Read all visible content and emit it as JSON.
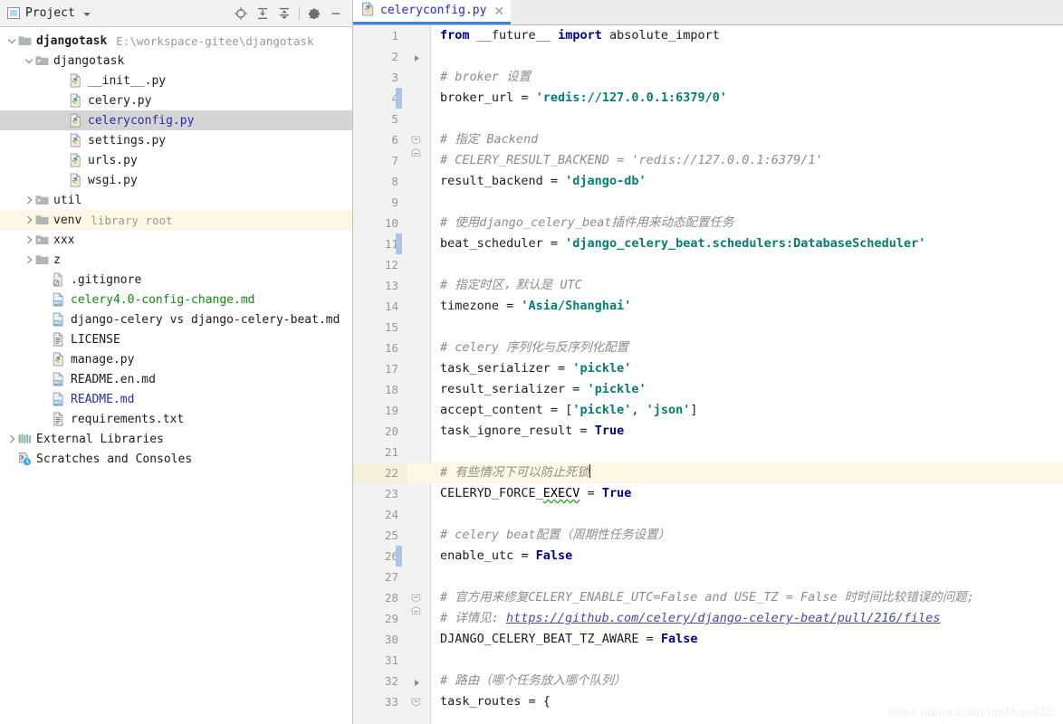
{
  "toolwindow": {
    "title": "Project",
    "icon": "project-panel-icon",
    "dropdown_icon": "chevron-down-icon",
    "buttons": [
      {
        "name": "locate-icon",
        "tooltip": "Select Opened File"
      },
      {
        "name": "expand-all-icon",
        "tooltip": "Expand All"
      },
      {
        "name": "collapse-all-icon",
        "tooltip": "Collapse All"
      },
      {
        "name": "settings-gear-icon",
        "tooltip": "Settings"
      },
      {
        "name": "hide-icon",
        "tooltip": "Hide"
      }
    ]
  },
  "tree": [
    {
      "label": "djangotask",
      "sub": "E:\\workspace-gitee\\djangotask",
      "indent": 0,
      "state": "expanded",
      "icon": "folder-icon",
      "color": "dark",
      "bold": true,
      "row": "project-root"
    },
    {
      "label": "djangotask",
      "sub": "",
      "indent": 1,
      "state": "expanded",
      "icon": "folder-source-icon",
      "color": "dark",
      "bold": false,
      "row": "package-djangotask"
    },
    {
      "label": "__init__.py",
      "sub": "",
      "indent": 3,
      "state": "leaf",
      "icon": "python-file-icon",
      "color": "dark",
      "bold": false,
      "row": "file-init"
    },
    {
      "label": "celery.py",
      "sub": "",
      "indent": 3,
      "state": "leaf",
      "icon": "python-file-icon",
      "color": "dark",
      "bold": false,
      "row": "file-celery"
    },
    {
      "label": "celeryconfig.py",
      "sub": "",
      "indent": 3,
      "state": "leaf",
      "icon": "python-file-icon",
      "color": "blue",
      "bold": false,
      "row": "file-celeryconfig",
      "selected": true
    },
    {
      "label": "settings.py",
      "sub": "",
      "indent": 3,
      "state": "leaf",
      "icon": "python-file-icon",
      "color": "dark",
      "bold": false,
      "row": "file-settings"
    },
    {
      "label": "urls.py",
      "sub": "",
      "indent": 3,
      "state": "leaf",
      "icon": "python-file-icon",
      "color": "dark",
      "bold": false,
      "row": "file-urls"
    },
    {
      "label": "wsgi.py",
      "sub": "",
      "indent": 3,
      "state": "leaf",
      "icon": "python-file-icon",
      "color": "dark",
      "bold": false,
      "row": "file-wsgi"
    },
    {
      "label": "util",
      "sub": "",
      "indent": 1,
      "state": "collapsed",
      "icon": "folder-source-icon",
      "color": "dark",
      "bold": false,
      "row": "folder-util"
    },
    {
      "label": "venv",
      "sub": "library root",
      "indent": 1,
      "state": "collapsed",
      "icon": "folder-icon",
      "color": "dark",
      "bold": false,
      "row": "folder-venv",
      "highlighted": true
    },
    {
      "label": "xxx",
      "sub": "",
      "indent": 1,
      "state": "collapsed",
      "icon": "folder-source-icon",
      "color": "dark",
      "bold": false,
      "row": "folder-xxx"
    },
    {
      "label": "z",
      "sub": "",
      "indent": 1,
      "state": "collapsed",
      "icon": "folder-icon",
      "color": "dark",
      "bold": false,
      "row": "folder-z"
    },
    {
      "label": ".gitignore",
      "sub": "",
      "indent": 2,
      "state": "leaf",
      "icon": "gitignore-file-icon",
      "color": "dark",
      "bold": false,
      "row": "file-gitignore"
    },
    {
      "label": "celery4.0-config-change.md",
      "sub": "",
      "indent": 2,
      "state": "leaf",
      "icon": "markdown-file-icon",
      "color": "green",
      "bold": false,
      "row": "file-celery4-config-change"
    },
    {
      "label": "django-celery vs django-celery-beat.md",
      "sub": "",
      "indent": 2,
      "state": "leaf",
      "icon": "markdown-file-icon",
      "color": "dark",
      "bold": false,
      "row": "file-django-celery-vs"
    },
    {
      "label": "LICENSE",
      "sub": "",
      "indent": 2,
      "state": "leaf",
      "icon": "text-file-icon",
      "color": "dark",
      "bold": false,
      "row": "file-license"
    },
    {
      "label": "manage.py",
      "sub": "",
      "indent": 2,
      "state": "leaf",
      "icon": "python-file-icon",
      "color": "dark",
      "bold": false,
      "row": "file-manage"
    },
    {
      "label": "README.en.md",
      "sub": "",
      "indent": 2,
      "state": "leaf",
      "icon": "markdown-file-icon",
      "color": "dark",
      "bold": false,
      "row": "file-readme-en"
    },
    {
      "label": "README.md",
      "sub": "",
      "indent": 2,
      "state": "leaf",
      "icon": "markdown-file-icon",
      "color": "blue",
      "bold": false,
      "row": "file-readme"
    },
    {
      "label": "requirements.txt",
      "sub": "",
      "indent": 2,
      "state": "leaf",
      "icon": "text-file-icon",
      "color": "dark",
      "bold": false,
      "row": "file-requirements"
    },
    {
      "label": "External Libraries",
      "sub": "",
      "indent": 0,
      "state": "collapsed",
      "icon": "libraries-icon",
      "color": "dark",
      "bold": false,
      "row": "node-external-libraries"
    },
    {
      "label": "Scratches and Consoles",
      "sub": "",
      "indent": 0,
      "state": "leaf",
      "icon": "scratches-icon",
      "color": "dark",
      "bold": false,
      "row": "node-scratches-and-consoles"
    }
  ],
  "editor": {
    "tab": {
      "name": "celeryconfig.py",
      "icon": "python-file-icon",
      "close_icon": "close-icon"
    },
    "current_line": 22,
    "lines": [
      {
        "n": 1,
        "change": false,
        "fold": "",
        "tokens": [
          {
            "t": "from",
            "c": "kw"
          },
          {
            "t": " __future__ ",
            "c": "pl"
          },
          {
            "t": "import",
            "c": "kw"
          },
          {
            "t": " absolute_import",
            "c": "pl"
          }
        ]
      },
      {
        "n": 2,
        "change": false,
        "fold": "triangle",
        "tokens": []
      },
      {
        "n": 3,
        "change": false,
        "fold": "",
        "tokens": [
          {
            "t": "# broker 设置",
            "c": "cm"
          }
        ]
      },
      {
        "n": 4,
        "change": true,
        "fold": "",
        "tokens": [
          {
            "t": "broker_url = ",
            "c": "pl"
          },
          {
            "t": "'redis://127.0.0.1:6379/0'",
            "c": "str"
          }
        ]
      },
      {
        "n": 5,
        "change": false,
        "fold": "",
        "tokens": []
      },
      {
        "n": 6,
        "change": false,
        "fold": "minus-top",
        "tokens": [
          {
            "t": "# 指定 Backend",
            "c": "cm"
          }
        ]
      },
      {
        "n": 7,
        "change": false,
        "fold": "minus-bottom",
        "tokens": [
          {
            "t": "# CELERY_RESULT_BACKEND = 'redis://127.0.0.1:6379/1'",
            "c": "cm"
          }
        ]
      },
      {
        "n": 8,
        "change": false,
        "fold": "",
        "tokens": [
          {
            "t": "result_backend = ",
            "c": "pl"
          },
          {
            "t": "'django-db'",
            "c": "str"
          }
        ]
      },
      {
        "n": 9,
        "change": false,
        "fold": "",
        "tokens": []
      },
      {
        "n": 10,
        "change": false,
        "fold": "",
        "tokens": [
          {
            "t": "# 使用django_celery_beat插件用来动态配置任务",
            "c": "cm"
          }
        ]
      },
      {
        "n": 11,
        "change": true,
        "fold": "",
        "tokens": [
          {
            "t": "beat_scheduler = ",
            "c": "pl"
          },
          {
            "t": "'django_celery_beat.schedulers:DatabaseScheduler'",
            "c": "str"
          }
        ]
      },
      {
        "n": 12,
        "change": false,
        "fold": "",
        "tokens": []
      },
      {
        "n": 13,
        "change": false,
        "fold": "",
        "tokens": [
          {
            "t": "# 指定时区，默认是 UTC",
            "c": "cm"
          }
        ]
      },
      {
        "n": 14,
        "change": false,
        "fold": "",
        "tokens": [
          {
            "t": "timezone = ",
            "c": "pl"
          },
          {
            "t": "'Asia/Shanghai'",
            "c": "str"
          }
        ]
      },
      {
        "n": 15,
        "change": false,
        "fold": "",
        "tokens": []
      },
      {
        "n": 16,
        "change": false,
        "fold": "",
        "tokens": [
          {
            "t": "# celery 序列化与反序列化配置",
            "c": "cm"
          }
        ]
      },
      {
        "n": 17,
        "change": false,
        "fold": "",
        "tokens": [
          {
            "t": "task_serializer = ",
            "c": "pl"
          },
          {
            "t": "'pickle'",
            "c": "str"
          }
        ]
      },
      {
        "n": 18,
        "change": false,
        "fold": "",
        "tokens": [
          {
            "t": "result_serializer = ",
            "c": "pl"
          },
          {
            "t": "'pickle'",
            "c": "str"
          }
        ]
      },
      {
        "n": 19,
        "change": false,
        "fold": "",
        "tokens": [
          {
            "t": "accept_content = [",
            "c": "pl"
          },
          {
            "t": "'pickle'",
            "c": "str"
          },
          {
            "t": ", ",
            "c": "pl"
          },
          {
            "t": "'json'",
            "c": "str"
          },
          {
            "t": "]",
            "c": "pl"
          }
        ]
      },
      {
        "n": 20,
        "change": false,
        "fold": "",
        "tokens": [
          {
            "t": "task_ignore_result = ",
            "c": "pl"
          },
          {
            "t": "True",
            "c": "kw"
          }
        ]
      },
      {
        "n": 21,
        "change": false,
        "fold": "",
        "tokens": []
      },
      {
        "n": 22,
        "change": false,
        "fold": "",
        "current": true,
        "tokens": [
          {
            "t": "# 有些情况下可以防止死锁",
            "c": "cm"
          },
          {
            "t": "",
            "c": "caret"
          }
        ]
      },
      {
        "n": 23,
        "change": false,
        "fold": "",
        "tokens": [
          {
            "t": "CELERYD_FORCE_",
            "c": "pl"
          },
          {
            "t": "EXECV",
            "c": "sq"
          },
          {
            "t": " = ",
            "c": "pl"
          },
          {
            "t": "True",
            "c": "kw"
          }
        ]
      },
      {
        "n": 24,
        "change": false,
        "fold": "",
        "tokens": []
      },
      {
        "n": 25,
        "change": false,
        "fold": "",
        "tokens": [
          {
            "t": "# celery beat配置（周期性任务设置）",
            "c": "cm"
          }
        ]
      },
      {
        "n": 26,
        "change": true,
        "fold": "",
        "tokens": [
          {
            "t": "enable_utc = ",
            "c": "pl"
          },
          {
            "t": "False",
            "c": "kw"
          }
        ]
      },
      {
        "n": 27,
        "change": false,
        "fold": "",
        "tokens": []
      },
      {
        "n": 28,
        "change": false,
        "fold": "minus-top",
        "tokens": [
          {
            "t": "# 官方用来修复CELERY_ENABLE_UTC=False and USE_TZ = False 时时间比较错误的问题;",
            "c": "cm"
          }
        ]
      },
      {
        "n": 29,
        "change": false,
        "fold": "minus-bottom",
        "tokens": [
          {
            "t": "# 详情见: ",
            "c": "cm"
          },
          {
            "t": "https://github.com/celery/django-celery-beat/pull/216/files",
            "c": "lnk"
          }
        ]
      },
      {
        "n": 30,
        "change": false,
        "fold": "",
        "tokens": [
          {
            "t": "DJANGO_CELERY_BEAT_TZ_AWARE = ",
            "c": "pl"
          },
          {
            "t": "False",
            "c": "kw"
          }
        ]
      },
      {
        "n": 31,
        "change": false,
        "fold": "",
        "tokens": []
      },
      {
        "n": 32,
        "change": false,
        "fold": "triangle",
        "tokens": [
          {
            "t": "# 路由（哪个任务放入哪个队列）",
            "c": "cm"
          }
        ]
      },
      {
        "n": 33,
        "change": false,
        "fold": "minus-top",
        "tokens": [
          {
            "t": "task_routes = {",
            "c": "pl"
          }
        ]
      }
    ]
  },
  "watermark": "https://blog.csdn.net/Aqu415"
}
